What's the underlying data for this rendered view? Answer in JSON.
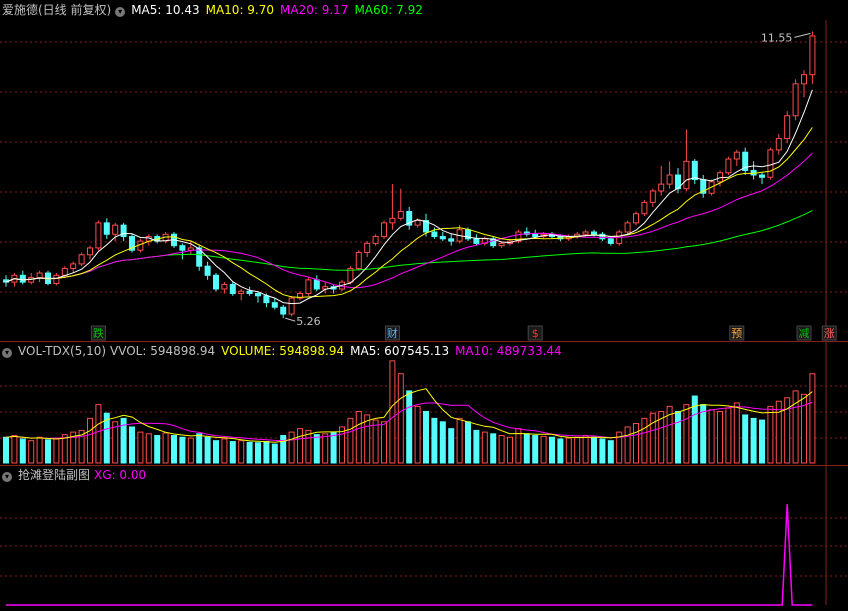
{
  "header": {
    "stock_name": "爱施德(日线 前复权)",
    "ma5": "MA5: 10.43",
    "ma10": "MA10: 9.70",
    "ma20": "MA20: 9.17",
    "ma60": "MA60: 7.92"
  },
  "volume_header": {
    "indicator": "VOL-TDX(5,10)",
    "vvol": "VVOL: 594898.94",
    "volume": "VOLUME: 594898.94",
    "ma5": "MA5: 607545.13",
    "ma10": "MA10: 489733.44"
  },
  "sub_header": {
    "name": "抢滩登陆副图",
    "xg": "XG: 0.00"
  },
  "colors": {
    "up": "#ff4b4b",
    "down": "#54fcfc",
    "ma5": "#ffffff",
    "ma10": "#ffff00",
    "ma20": "#ff00ff",
    "ma60": "#00ff00",
    "grid": "#8b1e1e",
    "text": "#c0c0c0"
  },
  "chart_data": {
    "type": "candlestick",
    "price_range": [
      5.0,
      11.8
    ],
    "highest_label": "11.55",
    "lowest_label": "5.26",
    "ohlc": [
      [
        6.1,
        6.2,
        5.95,
        6.05
      ],
      [
        6.05,
        6.25,
        5.95,
        6.2
      ],
      [
        6.2,
        6.3,
        6.0,
        6.05
      ],
      [
        6.05,
        6.25,
        6.0,
        6.15
      ],
      [
        6.15,
        6.3,
        6.05,
        6.25
      ],
      [
        6.25,
        6.3,
        5.98,
        6.02
      ],
      [
        6.02,
        6.25,
        5.98,
        6.2
      ],
      [
        6.2,
        6.4,
        6.15,
        6.35
      ],
      [
        6.35,
        6.5,
        6.25,
        6.45
      ],
      [
        6.45,
        6.7,
        6.4,
        6.65
      ],
      [
        6.65,
        6.85,
        6.55,
        6.8
      ],
      [
        6.8,
        7.4,
        6.75,
        7.35
      ],
      [
        7.35,
        7.45,
        7.0,
        7.1
      ],
      [
        7.1,
        7.35,
        6.95,
        7.3
      ],
      [
        7.3,
        7.35,
        6.95,
        7.05
      ],
      [
        7.05,
        7.1,
        6.7,
        6.75
      ],
      [
        6.75,
        7.0,
        6.7,
        6.95
      ],
      [
        6.95,
        7.1,
        6.85,
        7.05
      ],
      [
        7.05,
        7.1,
        6.9,
        6.95
      ],
      [
        6.95,
        7.15,
        6.9,
        7.1
      ],
      [
        7.1,
        7.15,
        6.8,
        6.85
      ],
      [
        6.85,
        6.9,
        6.55,
        6.75
      ],
      [
        6.75,
        6.95,
        6.65,
        6.8
      ],
      [
        6.8,
        6.85,
        6.3,
        6.4
      ],
      [
        6.4,
        6.5,
        6.1,
        6.2
      ],
      [
        6.2,
        6.25,
        5.85,
        5.9
      ],
      [
        5.9,
        6.05,
        5.8,
        6.0
      ],
      [
        6.0,
        6.05,
        5.75,
        5.8
      ],
      [
        5.8,
        5.9,
        5.65,
        5.85
      ],
      [
        5.85,
        5.95,
        5.75,
        5.8
      ],
      [
        5.8,
        5.85,
        5.6,
        5.75
      ],
      [
        5.75,
        5.8,
        5.5,
        5.6
      ],
      [
        5.6,
        5.7,
        5.45,
        5.5
      ],
      [
        5.5,
        5.55,
        5.26,
        5.35
      ],
      [
        5.35,
        5.75,
        5.3,
        5.7
      ],
      [
        5.7,
        5.85,
        5.65,
        5.8
      ],
      [
        5.8,
        6.15,
        5.75,
        6.1
      ],
      [
        6.1,
        6.2,
        5.85,
        5.9
      ],
      [
        5.9,
        6.05,
        5.8,
        5.95
      ],
      [
        5.95,
        6.0,
        5.8,
        5.9
      ],
      [
        5.9,
        6.1,
        5.85,
        6.05
      ],
      [
        6.05,
        6.4,
        6.0,
        6.35
      ],
      [
        6.35,
        6.75,
        6.3,
        6.7
      ],
      [
        6.7,
        6.95,
        6.6,
        6.9
      ],
      [
        6.9,
        7.1,
        6.85,
        7.05
      ],
      [
        7.05,
        7.4,
        7.0,
        7.35
      ],
      [
        7.35,
        8.2,
        7.2,
        7.45
      ],
      [
        7.45,
        8.1,
        7.4,
        7.6
      ],
      [
        7.6,
        7.7,
        7.2,
        7.3
      ],
      [
        7.3,
        7.45,
        7.25,
        7.4
      ],
      [
        7.4,
        7.55,
        7.05,
        7.15
      ],
      [
        7.15,
        7.25,
        7.0,
        7.05
      ],
      [
        7.05,
        7.15,
        6.95,
        7.0
      ],
      [
        7.0,
        7.1,
        6.85,
        6.95
      ],
      [
        6.95,
        7.3,
        6.9,
        7.2
      ],
      [
        7.2,
        7.25,
        6.95,
        7.0
      ],
      [
        7.0,
        7.1,
        6.85,
        6.9
      ],
      [
        6.9,
        7.05,
        6.85,
        7.0
      ],
      [
        7.0,
        7.05,
        6.8,
        6.85
      ],
      [
        6.85,
        6.95,
        6.8,
        6.9
      ],
      [
        6.9,
        7.0,
        6.85,
        6.95
      ],
      [
        6.95,
        7.2,
        6.9,
        7.15
      ],
      [
        7.15,
        7.25,
        7.05,
        7.1
      ],
      [
        7.1,
        7.2,
        7.0,
        7.05
      ],
      [
        7.05,
        7.15,
        7.0,
        7.1
      ],
      [
        7.1,
        7.15,
        7.0,
        7.05
      ],
      [
        7.05,
        7.1,
        6.95,
        7.0
      ],
      [
        7.0,
        7.1,
        6.95,
        7.05
      ],
      [
        7.05,
        7.15,
        7.0,
        7.1
      ],
      [
        7.1,
        7.2,
        7.05,
        7.15
      ],
      [
        7.15,
        7.2,
        7.05,
        7.1
      ],
      [
        7.1,
        7.15,
        6.95,
        7.0
      ],
      [
        7.0,
        7.05,
        6.85,
        6.9
      ],
      [
        6.9,
        7.2,
        6.85,
        7.15
      ],
      [
        7.15,
        7.4,
        7.1,
        7.35
      ],
      [
        7.35,
        7.6,
        7.3,
        7.55
      ],
      [
        7.55,
        7.85,
        7.5,
        7.8
      ],
      [
        7.8,
        8.1,
        7.7,
        8.05
      ],
      [
        8.05,
        8.6,
        7.95,
        8.2
      ],
      [
        8.2,
        8.7,
        8.1,
        8.4
      ],
      [
        8.4,
        8.55,
        8.0,
        8.1
      ],
      [
        8.1,
        9.4,
        8.05,
        8.7
      ],
      [
        8.7,
        8.75,
        8.2,
        8.3
      ],
      [
        8.3,
        8.4,
        7.9,
        8.0
      ],
      [
        8.0,
        8.3,
        7.95,
        8.25
      ],
      [
        8.25,
        8.5,
        8.15,
        8.45
      ],
      [
        8.45,
        8.8,
        8.4,
        8.75
      ],
      [
        8.75,
        8.95,
        8.6,
        8.9
      ],
      [
        8.9,
        9.0,
        8.4,
        8.5
      ],
      [
        8.5,
        8.7,
        8.3,
        8.4
      ],
      [
        8.4,
        8.45,
        8.2,
        8.35
      ],
      [
        8.35,
        9.0,
        8.3,
        8.95
      ],
      [
        8.95,
        9.3,
        8.85,
        9.2
      ],
      [
        9.2,
        9.8,
        9.1,
        9.7
      ],
      [
        9.7,
        10.5,
        9.6,
        10.4
      ],
      [
        10.4,
        10.7,
        10.1,
        10.6
      ],
      [
        10.6,
        11.55,
        10.4,
        11.45
      ]
    ],
    "volume_range": [
      0,
      600000
    ],
    "volume": [
      150000,
      160000,
      140000,
      130000,
      150000,
      135000,
      145000,
      165000,
      180000,
      190000,
      260000,
      340000,
      290000,
      240000,
      260000,
      210000,
      180000,
      170000,
      160000,
      175000,
      160000,
      150000,
      145000,
      170000,
      150000,
      130000,
      140000,
      125000,
      130000,
      120000,
      118000,
      125000,
      110000,
      160000,
      180000,
      200000,
      190000,
      165000,
      170000,
      180000,
      210000,
      260000,
      300000,
      280000,
      250000,
      240000,
      594898,
      520000,
      420000,
      330000,
      300000,
      260000,
      240000,
      200000,
      260000,
      240000,
      190000,
      180000,
      170000,
      160000,
      150000,
      200000,
      170000,
      160000,
      155000,
      150000,
      140000,
      145000,
      150000,
      160000,
      150000,
      140000,
      130000,
      180000,
      210000,
      230000,
      260000,
      290000,
      300000,
      330000,
      300000,
      340000,
      390000,
      340000,
      310000,
      300000,
      320000,
      350000,
      280000,
      260000,
      250000,
      330000,
      360000,
      380000,
      420000,
      400000,
      520000
    ],
    "xg_spike_index": 93,
    "xg_range": [
      0,
      1.2
    ],
    "xg_spike_value": 1.0
  },
  "annotations": {
    "events": [
      {
        "label": "跌",
        "index": 11,
        "color": "#00c000"
      },
      {
        "label": "财",
        "index": 46,
        "color": "#5fb0ff"
      },
      {
        "label": "$",
        "index": 63,
        "color": "#ff3030"
      },
      {
        "label": "预",
        "index": 87,
        "color": "#ffaa44"
      },
      {
        "label": "减",
        "index": 95,
        "color": "#00c000"
      },
      {
        "label": "涨",
        "index": 98,
        "color": "#ff6060"
      }
    ]
  }
}
